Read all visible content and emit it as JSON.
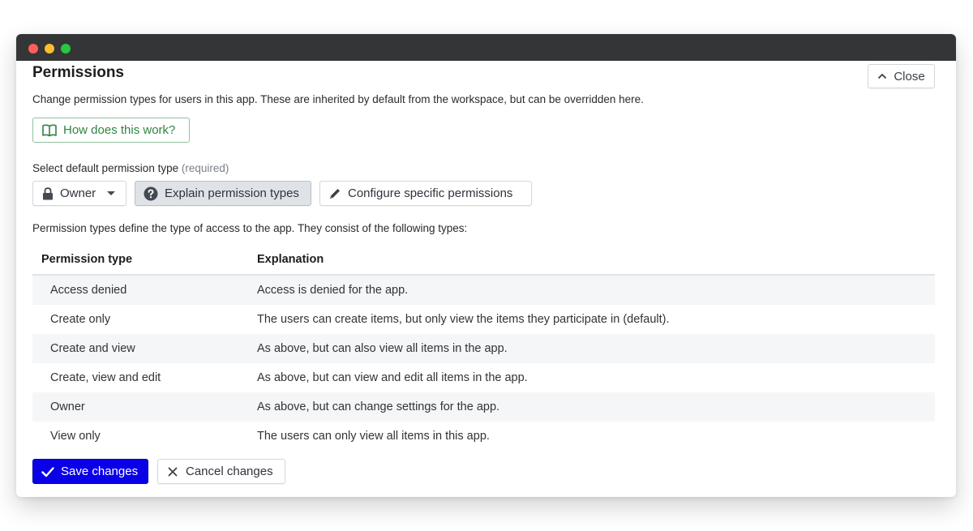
{
  "window": {
    "controls": [
      "close",
      "minimize",
      "maximize"
    ]
  },
  "header": {
    "title": "Permissions",
    "close_label": "Close",
    "close_icon": "chevron-up-icon"
  },
  "description": "Change permission types for users in this app. These are inherited by default from the workspace, but can be overridden here.",
  "help_button": {
    "label": "How does this work?",
    "icon": "book-icon"
  },
  "select": {
    "label": "Select default permission type",
    "required_hint": "(required)",
    "selected_value": "Owner",
    "icon": "lock-icon"
  },
  "actions": {
    "explain_label": "Explain permission types",
    "explain_icon": "question-circle-icon",
    "configure_label": "Configure specific permissions",
    "configure_icon": "pencil-icon"
  },
  "intro": "Permission types define the type of access to the app. They consist of the following types:",
  "table": {
    "columns": [
      "Permission type",
      "Explanation"
    ],
    "rows": [
      {
        "type": "Access denied",
        "explanation": "Access is denied for the app."
      },
      {
        "type": "Create only",
        "explanation": "The users can create items, but only view the items they participate in (default)."
      },
      {
        "type": "Create and view",
        "explanation": "As above, but can also view all items in the app."
      },
      {
        "type": "Create, view and edit",
        "explanation": "As above, but can view and edit all items in the app."
      },
      {
        "type": "Owner",
        "explanation": "As above, but can change settings for the app."
      },
      {
        "type": "View only",
        "explanation": "The users can only view all items in this app."
      }
    ]
  },
  "footer": {
    "save_label": "Save changes",
    "cancel_label": "Cancel changes"
  },
  "colors": {
    "primary": "#0a00e8",
    "help_green": "#2e8540",
    "titlebar": "#343537"
  }
}
